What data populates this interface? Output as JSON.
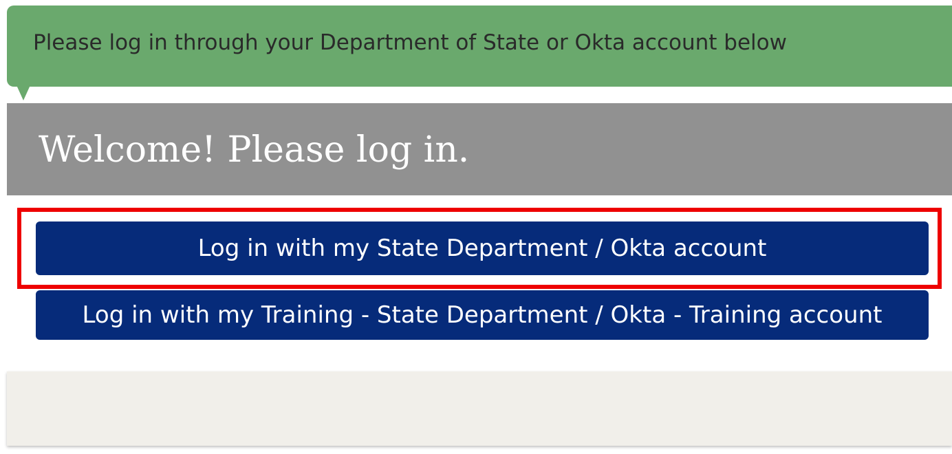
{
  "notice": {
    "message": "Please log in through your Department of State or Okta account below"
  },
  "login_panel": {
    "title": "Welcome! Please log in.",
    "buttons": [
      {
        "label": "Log in with my State Department / Okta account",
        "highlighted": true
      },
      {
        "label": "Log in with my Training - State Department / Okta - Training account",
        "highlighted": false
      }
    ]
  },
  "colors": {
    "notice_bg": "#6aa96d",
    "header_bg": "#919191",
    "button_bg": "#062b7a",
    "highlight_border": "#ee0000",
    "footer_bg": "#f1efea"
  }
}
